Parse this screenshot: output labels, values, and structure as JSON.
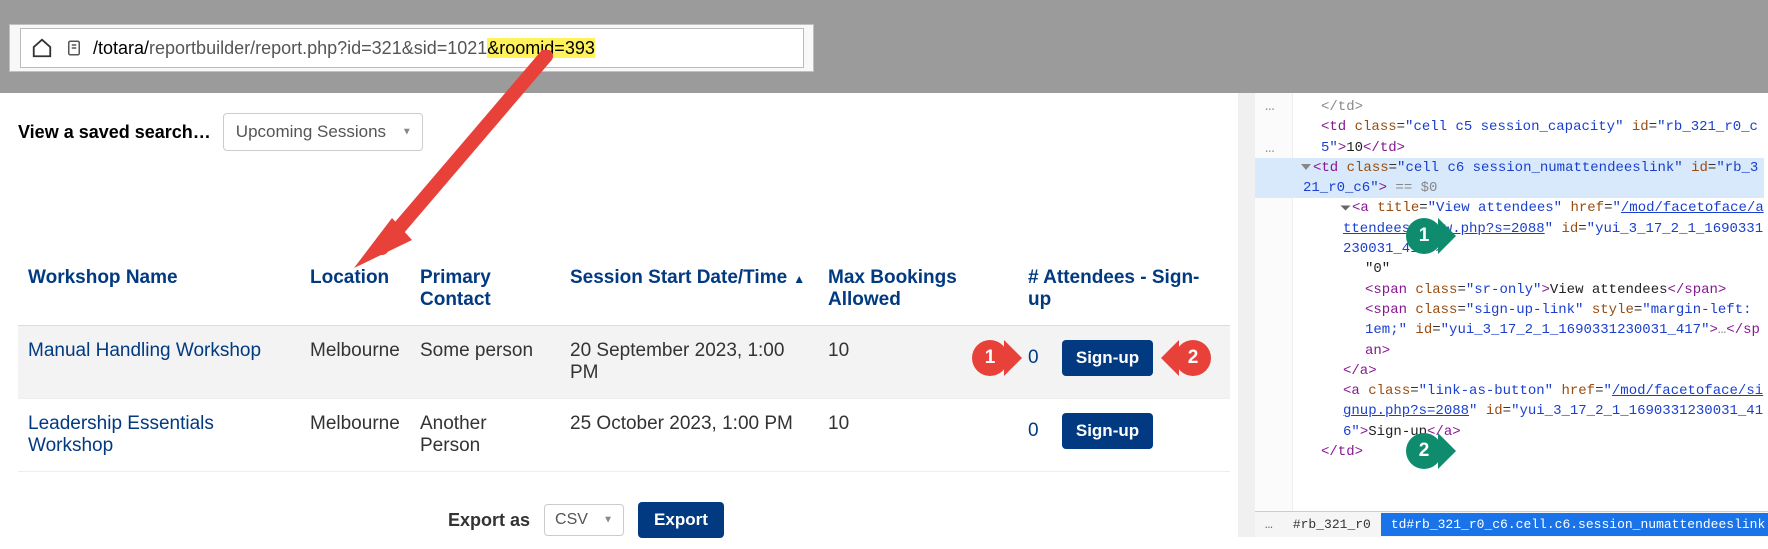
{
  "url": {
    "prefix": "/totara/",
    "path_rest": "reportbuilder/report.php?id=321&sid=1021",
    "highlight_segment": "&roomid=393"
  },
  "saved_search": {
    "label": "View a saved search…",
    "selected": "Upcoming Sessions"
  },
  "table": {
    "headers": {
      "workshop": "Workshop Name",
      "location": "Location",
      "contact": "Primary Contact",
      "startdate": "Session Start Date/Time",
      "maxbook": "Max Bookings Allowed",
      "attendees": "# Attendees - Sign-up"
    },
    "rows": [
      {
        "workshop": "Manual Handling Workshop",
        "location": "Melbourne",
        "contact": "Some person",
        "startdate": "20 September 2023, 1:00 PM",
        "maxbook": "10",
        "attendees": "0",
        "signup": "Sign-up"
      },
      {
        "workshop": "Leadership Essentials Workshop",
        "location": "Melbourne",
        "contact": "Another Person",
        "startdate": "25 October 2023, 1:00 PM",
        "maxbook": "10",
        "attendees": "0",
        "signup": "Sign-up"
      }
    ]
  },
  "export": {
    "label": "Export as",
    "format": "CSV",
    "button": "Export"
  },
  "annotations": {
    "red1": "1",
    "red2": "2",
    "teal1": "1",
    "teal2": "2"
  },
  "devtools": {
    "ellipsis1": "…",
    "ellipsis2": "…",
    "td_c5_open": "<td class=\"cell c5 session_capacity\" id=\"rb_321_r0_c5\">",
    "td_c5_text": "10",
    "td_c5_close": "</td>",
    "td_c6_open_1": "<td class=\"cell c6 session_numattendeeslink\" id=\"rb_321_r0_c6\">",
    "td_c6_eqdollar": " == $0",
    "a1_open_part1": "<a title=\"View attendees\" href=\"",
    "a1_href": "/mod/facetoface/attendees/view.php?s=2088",
    "a1_open_part2": "\" id=\"yui_3_17_2_1_1690331230031_418\">",
    "a1_text": "\"0\"",
    "span_sr_open": "<span class=\"sr-only\">",
    "span_sr_text": "View attendees",
    "span_sr_close": "</span>",
    "span_su_open": "<span class=\"sign-up-link\" style=\"margin-left: 1em;\" id=\"yui_3_17_2_1_1690331230031_417\">",
    "span_su_ell": "…",
    "span_su_close": "</span>",
    "a1_close": "</a>",
    "a2_open_part1": "<a class=\"link-as-button\" href=\"",
    "a2_href": "/mod/facetoface/signup.php?s=2088",
    "a2_open_part2": "\" id=\"yui_3_17_2_1_1690331230031_416\">",
    "a2_text": "Sign-up",
    "a2_close": "</a>",
    "td_c6_close": "</td>",
    "td_close_extra": "</td>",
    "breadcrumb_dots": "…",
    "breadcrumb1": "#rb_321_r0",
    "breadcrumb2": "td#rb_321_r0_c6.cell.c6.session_numattendeeslink"
  }
}
